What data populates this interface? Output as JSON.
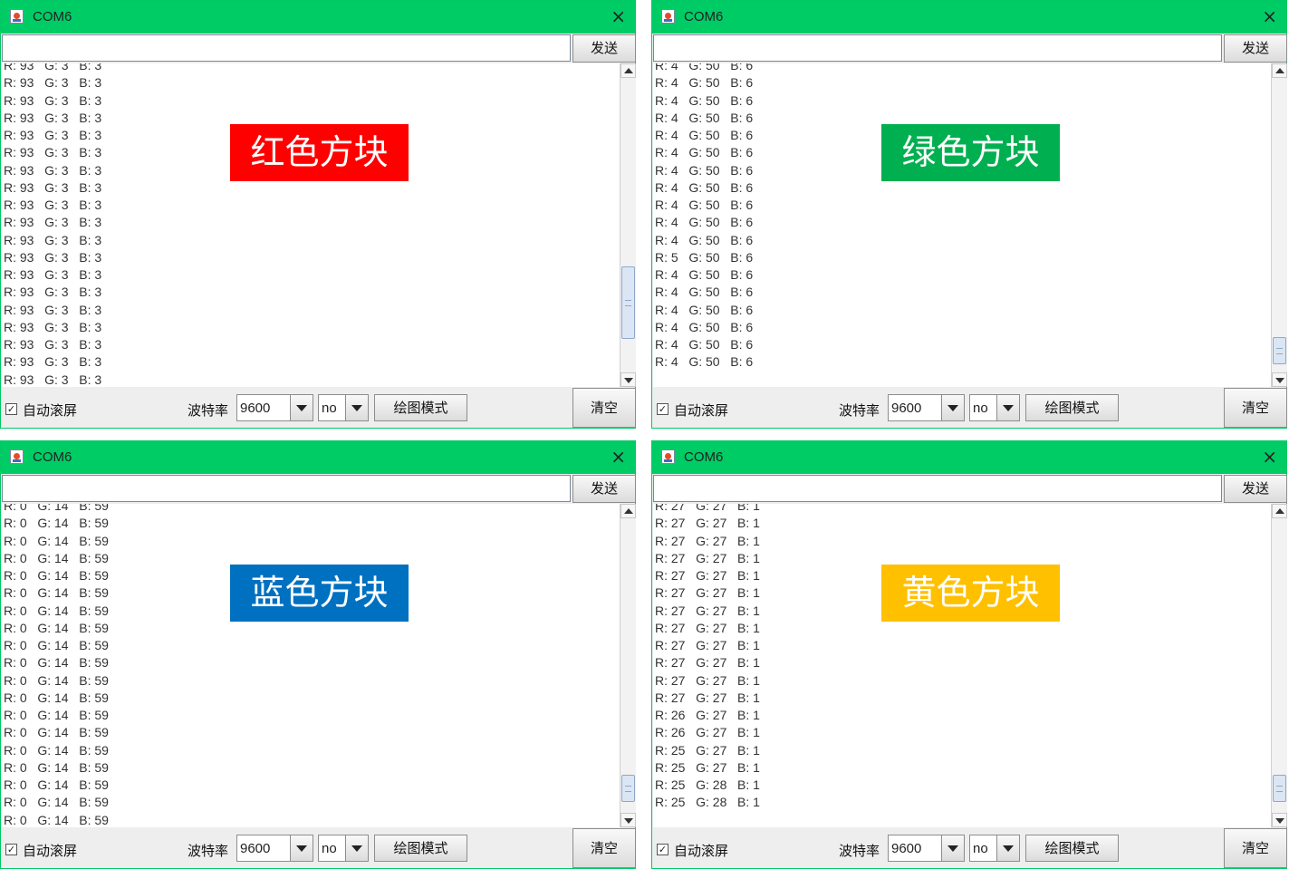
{
  "windows": [
    {
      "title": "COM6",
      "close_icon": "×",
      "send_label": "发送",
      "input_value": "",
      "label": "红色方块",
      "label_color": "#ff0000",
      "lines": [
        "R: 93   G: 3   B: 3",
        "R: 93   G: 3   B: 3",
        "R: 93   G: 3   B: 3",
        "R: 93   G: 3   B: 3",
        "R: 93   G: 3   B: 3",
        "R: 93   G: 3   B: 3",
        "R: 93   G: 3   B: 3",
        "R: 93   G: 3   B: 3",
        "R: 93   G: 3   B: 3",
        "R: 93   G: 3   B: 3",
        "R: 93   G: 3   B: 3",
        "R: 93   G: 3   B: 3",
        "R: 93   G: 3   B: 3",
        "R: 93   G: 3   B: 3",
        "R: 93   G: 3   B: 3",
        "R: 93   G: 3   B: 3",
        "R: 93   G: 3   B: 3",
        "R: 93   G: 3   B: 3",
        "R: 93   G: 3   B: 3"
      ],
      "autoscroll_label": "自动滚屏",
      "autoscroll_checked": true,
      "baud_label": "波特率",
      "baud_value": "9600",
      "line_ending_value": "no",
      "plot_label": "绘图模式",
      "clear_label": "清空",
      "scroll_position": 0.85
    },
    {
      "title": "COM6",
      "close_icon": "×",
      "send_label": "发送",
      "input_value": "",
      "label": "绿色方块",
      "label_color": "#00b050",
      "lines": [
        "R: 4   G: 50   B: 6",
        "R: 4   G: 50   B: 6",
        "R: 4   G: 50   B: 6",
        "R: 4   G: 50   B: 6",
        "R: 4   G: 50   B: 6",
        "R: 4   G: 50   B: 6",
        "R: 4   G: 50   B: 6",
        "R: 4   G: 50   B: 6",
        "R: 4   G: 50   B: 6",
        "R: 4   G: 50   B: 6",
        "R: 4   G: 50   B: 6",
        "R: 5   G: 50   B: 6",
        "R: 4   G: 50   B: 6",
        "R: 4   G: 50   B: 6",
        "R: 4   G: 50   B: 6",
        "R: 4   G: 50   B: 6",
        "R: 4   G: 50   B: 6",
        "R: 4   G: 50   B: 6"
      ],
      "autoscroll_label": "自动滚屏",
      "autoscroll_checked": true,
      "baud_label": "波特率",
      "baud_value": "9600",
      "line_ending_value": "no",
      "plot_label": "绘图模式",
      "clear_label": "清空",
      "scroll_position": 0.97
    },
    {
      "title": "COM6",
      "close_icon": "×",
      "send_label": "发送",
      "input_value": "",
      "label": "蓝色方块",
      "label_color": "#0070c0",
      "lines": [
        "R: 0   G: 14   B: 59",
        "R: 0   G: 14   B: 59",
        "R: 0   G: 14   B: 59",
        "R: 0   G: 14   B: 59",
        "R: 0   G: 14   B: 59",
        "R: 0   G: 14   B: 59",
        "R: 0   G: 14   B: 59",
        "R: 0   G: 14   B: 59",
        "R: 0   G: 14   B: 59",
        "R: 0   G: 14   B: 59",
        "R: 0   G: 14   B: 59",
        "R: 0   G: 14   B: 59",
        "R: 0   G: 14   B: 59",
        "R: 0   G: 14   B: 59",
        "R: 0   G: 14   B: 59",
        "R: 0   G: 14   B: 59",
        "R: 0   G: 14   B: 59",
        "R: 0   G: 14   B: 59",
        "R: 0   G: 14   B: 59"
      ],
      "autoscroll_label": "自动滚屏",
      "autoscroll_checked": true,
      "baud_label": "波特率",
      "baud_value": "9600",
      "line_ending_value": "no",
      "plot_label": "绘图模式",
      "clear_label": "清空",
      "scroll_position": 0.96
    },
    {
      "title": "COM6",
      "close_icon": "×",
      "send_label": "发送",
      "input_value": "",
      "label": "黄色方块",
      "label_color": "#ffc000",
      "lines": [
        "R: 27   G: 27   B: 1",
        "R: 27   G: 27   B: 1",
        "R: 27   G: 27   B: 1",
        "R: 27   G: 27   B: 1",
        "R: 27   G: 27   B: 1",
        "R: 27   G: 27   B: 1",
        "R: 27   G: 27   B: 1",
        "R: 27   G: 27   B: 1",
        "R: 27   G: 27   B: 1",
        "R: 27   G: 27   B: 1",
        "R: 27   G: 27   B: 1",
        "R: 27   G: 27   B: 1",
        "R: 26   G: 27   B: 1",
        "R: 26   G: 27   B: 1",
        "R: 25   G: 27   B: 1",
        "R: 25   G: 27   B: 1",
        "R: 25   G: 28   B: 1",
        "R: 25   G: 28   B: 1"
      ],
      "autoscroll_label": "自动滚屏",
      "autoscroll_checked": true,
      "baud_label": "波特率",
      "baud_value": "9600",
      "line_ending_value": "no",
      "plot_label": "绘图模式",
      "clear_label": "清空",
      "scroll_position": 0.96
    }
  ]
}
